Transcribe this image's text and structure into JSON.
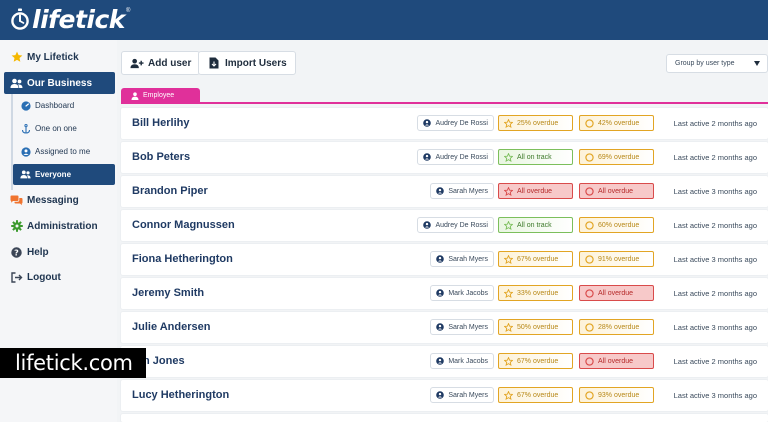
{
  "brand": {
    "name": "lifetick",
    "reg": "®"
  },
  "sidebar": {
    "items": [
      {
        "label": "My Lifetick",
        "icon": "star-icon"
      },
      {
        "label": "Our Business",
        "icon": "users-icon"
      },
      {
        "label": "Messaging",
        "icon": "chat-icon"
      },
      {
        "label": "Administration",
        "icon": "gear-icon"
      },
      {
        "label": "Help",
        "icon": "help-icon"
      },
      {
        "label": "Logout",
        "icon": "logout-icon"
      }
    ],
    "sub_items": [
      {
        "label": "Dashboard",
        "icon": "dashboard-icon"
      },
      {
        "label": "One on one",
        "icon": "anchor-icon"
      },
      {
        "label": "Assigned to me",
        "icon": "user-circle-icon"
      },
      {
        "label": "Everyone",
        "icon": "group-icon"
      }
    ]
  },
  "toolbar": {
    "add_user_label": "Add user",
    "import_users_label": "Import Users",
    "group_by_label": "Group by user type"
  },
  "tab": {
    "label": "Employee"
  },
  "colors": {
    "header": "#1f4a7c",
    "accent": "#e0309a",
    "warn": "#e2a524",
    "good": "#7cbf5c",
    "bad": "#d94b4b"
  },
  "employees": [
    {
      "name": "Bill Herlihy",
      "manager": "Audrey De Rossi",
      "status1": {
        "label": "25% overdue",
        "kind": "warn"
      },
      "status2": {
        "label": "42% overdue",
        "kind": "warn"
      },
      "last_active": "Last active 2 months ago"
    },
    {
      "name": "Bob Peters",
      "manager": "Audrey De Rossi",
      "status1": {
        "label": "All on track",
        "kind": "good"
      },
      "status2": {
        "label": "69% overdue",
        "kind": "warn"
      },
      "last_active": "Last active 2 months ago"
    },
    {
      "name": "Brandon Piper",
      "manager": "Sarah Myers",
      "status1": {
        "label": "All overdue",
        "kind": "bad"
      },
      "status2": {
        "label": "All overdue",
        "kind": "bad"
      },
      "last_active": "Last active 3 months ago"
    },
    {
      "name": "Connor Magnussen",
      "manager": "Audrey De Rossi",
      "status1": {
        "label": "All on track",
        "kind": "good"
      },
      "status2": {
        "label": "60% overdue",
        "kind": "warn"
      },
      "last_active": "Last active 2 months ago"
    },
    {
      "name": "Fiona Hetherington",
      "manager": "Sarah Myers",
      "status1": {
        "label": "67% overdue",
        "kind": "warn"
      },
      "status2": {
        "label": "91% overdue",
        "kind": "warn"
      },
      "last_active": "Last active 3 months ago"
    },
    {
      "name": "Jeremy Smith",
      "manager": "Mark Jacobs",
      "status1": {
        "label": "33% overdue",
        "kind": "warn"
      },
      "status2": {
        "label": "All overdue",
        "kind": "bad"
      },
      "last_active": "Last active 2 months ago"
    },
    {
      "name": "Julie Andersen",
      "manager": "Sarah Myers",
      "status1": {
        "label": "50% overdue",
        "kind": "warn"
      },
      "status2": {
        "label": "28% overdue",
        "kind": "warn"
      },
      "last_active": "Last active 3 months ago"
    },
    {
      "name": "n Jones",
      "manager": "Mark Jacobs",
      "status1": {
        "label": "67% overdue",
        "kind": "warn"
      },
      "status2": {
        "label": "All overdue",
        "kind": "bad"
      },
      "last_active": "Last active 2 months ago"
    },
    {
      "name": "Lucy Hetherington",
      "manager": "Sarah Myers",
      "status1": {
        "label": "67% overdue",
        "kind": "warn"
      },
      "status2": {
        "label": "93% overdue",
        "kind": "warn"
      },
      "last_active": "Last active 3 months ago"
    }
  ],
  "watermark": {
    "text": "lifetick.com"
  }
}
